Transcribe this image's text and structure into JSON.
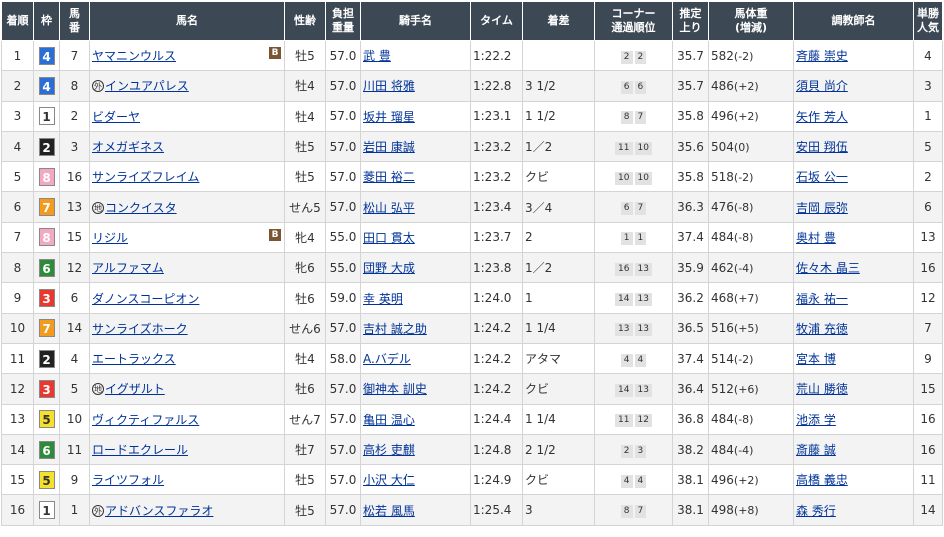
{
  "headers": {
    "rank": "着順",
    "waku": "枠",
    "umaban_1": "馬",
    "umaban_2": "番",
    "horse": "馬名",
    "sexage": "性齢",
    "weight_1": "負担",
    "weight_2": "重量",
    "jockey": "騎手名",
    "time": "タイム",
    "margin": "着差",
    "corner_1": "コーナー",
    "corner_2": "通過順位",
    "last3f_1": "推定",
    "last3f_2": "上り",
    "bw_1": "馬体重",
    "bw_2": "(増減)",
    "trainer": "調教師名",
    "pop_1": "単勝",
    "pop_2": "人気"
  },
  "waku_colors": {
    "1": {
      "bg": "#ffffff",
      "fg": "#333333"
    },
    "2": {
      "bg": "#222222",
      "fg": "#ffffff"
    },
    "3": {
      "bg": "#e8382f",
      "fg": "#ffffff"
    },
    "4": {
      "bg": "#2a6fd6",
      "fg": "#ffffff"
    },
    "5": {
      "bg": "#f5e12c",
      "fg": "#333333"
    },
    "6": {
      "bg": "#2f8a3b",
      "fg": "#ffffff"
    },
    "7": {
      "bg": "#f29b1d",
      "fg": "#ffffff"
    },
    "8": {
      "bg": "#f3a8c4",
      "fg": "#ffffff"
    }
  },
  "rows": [
    {
      "rank": "1",
      "waku": "4",
      "umaban": "7",
      "mark": "",
      "horse": "ヤマニンウルス",
      "blinker": "B",
      "sexage": "牡5",
      "weight": "57.0",
      "jockey": "武 豊",
      "time": "1:22.2",
      "margin": "",
      "c1": "2",
      "c2": "2",
      "last3f": "35.7",
      "bw": "582",
      "bwdiff": "(-2)",
      "trainer": "斉藤 崇史",
      "pop": "4"
    },
    {
      "rank": "2",
      "waku": "4",
      "umaban": "8",
      "mark": "外",
      "horse": "インユアパレス",
      "blinker": "",
      "sexage": "牡4",
      "weight": "57.0",
      "jockey": "川田 将雅",
      "time": "1:22.8",
      "margin": "3 1/2",
      "c1": "6",
      "c2": "6",
      "last3f": "35.7",
      "bw": "486",
      "bwdiff": "(+2)",
      "trainer": "須貝 尚介",
      "pop": "3"
    },
    {
      "rank": "3",
      "waku": "1",
      "umaban": "2",
      "mark": "",
      "horse": "ビダーヤ",
      "blinker": "",
      "sexage": "牡4",
      "weight": "57.0",
      "jockey": "坂井 瑠星",
      "time": "1:23.1",
      "margin": "1 1/2",
      "c1": "8",
      "c2": "7",
      "last3f": "35.8",
      "bw": "496",
      "bwdiff": "(+2)",
      "trainer": "矢作 芳人",
      "pop": "1"
    },
    {
      "rank": "4",
      "waku": "2",
      "umaban": "3",
      "mark": "",
      "horse": "オメガギネス",
      "blinker": "",
      "sexage": "牡5",
      "weight": "57.0",
      "jockey": "岩田 康誠",
      "time": "1:23.2",
      "margin": "1／2",
      "c1": "11",
      "c2": "10",
      "last3f": "35.6",
      "bw": "504",
      "bwdiff": "(0)",
      "trainer": "安田 翔伍",
      "pop": "5"
    },
    {
      "rank": "5",
      "waku": "8",
      "umaban": "16",
      "mark": "",
      "horse": "サンライズフレイム",
      "blinker": "",
      "sexage": "牡5",
      "weight": "57.0",
      "jockey": "菱田 裕二",
      "time": "1:23.2",
      "margin": "クビ",
      "c1": "10",
      "c2": "10",
      "last3f": "35.8",
      "bw": "518",
      "bwdiff": "(-2)",
      "trainer": "石坂 公一",
      "pop": "2"
    },
    {
      "rank": "6",
      "waku": "7",
      "umaban": "13",
      "mark": "地",
      "horse": "コンクイスタ",
      "blinker": "",
      "sexage": "せん5",
      "weight": "57.0",
      "jockey": "松山 弘平",
      "time": "1:23.4",
      "margin": "3／4",
      "c1": "6",
      "c2": "7",
      "last3f": "36.3",
      "bw": "476",
      "bwdiff": "(-8)",
      "trainer": "吉岡 辰弥",
      "pop": "6"
    },
    {
      "rank": "7",
      "waku": "8",
      "umaban": "15",
      "mark": "",
      "horse": "リジル",
      "blinker": "B",
      "sexage": "牝4",
      "weight": "55.0",
      "jockey": "田口 貫太",
      "time": "1:23.7",
      "margin": "2",
      "c1": "1",
      "c2": "1",
      "last3f": "37.4",
      "bw": "484",
      "bwdiff": "(-8)",
      "trainer": "奥村 豊",
      "pop": "13"
    },
    {
      "rank": "8",
      "waku": "6",
      "umaban": "12",
      "mark": "",
      "horse": "アルファマム",
      "blinker": "",
      "sexage": "牝6",
      "weight": "55.0",
      "jockey": "団野 大成",
      "time": "1:23.8",
      "margin": "1／2",
      "c1": "16",
      "c2": "13",
      "last3f": "35.9",
      "bw": "462",
      "bwdiff": "(-4)",
      "trainer": "佐々木 晶三",
      "pop": "16"
    },
    {
      "rank": "9",
      "waku": "3",
      "umaban": "6",
      "mark": "",
      "horse": "ダノンスコーピオン",
      "blinker": "",
      "sexage": "牡6",
      "weight": "59.0",
      "jockey": "幸 英明",
      "time": "1:24.0",
      "margin": "1",
      "c1": "14",
      "c2": "13",
      "last3f": "36.2",
      "bw": "468",
      "bwdiff": "(+7)",
      "trainer": "福永 祐一",
      "pop": "12"
    },
    {
      "rank": "10",
      "waku": "7",
      "umaban": "14",
      "mark": "",
      "horse": "サンライズホーク",
      "blinker": "",
      "sexage": "せん6",
      "weight": "57.0",
      "jockey": "吉村 誠之助",
      "time": "1:24.2",
      "margin": "1 1/4",
      "c1": "13",
      "c2": "13",
      "last3f": "36.5",
      "bw": "516",
      "bwdiff": "(+5)",
      "trainer": "牧浦 充徳",
      "pop": "7"
    },
    {
      "rank": "11",
      "waku": "2",
      "umaban": "4",
      "mark": "",
      "horse": "エートラックス",
      "blinker": "",
      "sexage": "牡4",
      "weight": "58.0",
      "jockey": "A.バデル",
      "time": "1:24.2",
      "margin": "アタマ",
      "c1": "4",
      "c2": "4",
      "last3f": "37.4",
      "bw": "514",
      "bwdiff": "(-2)",
      "trainer": "宮本 博",
      "pop": "9"
    },
    {
      "rank": "12",
      "waku": "3",
      "umaban": "5",
      "mark": "地",
      "horse": "イグザルト",
      "blinker": "",
      "sexage": "牡6",
      "weight": "57.0",
      "jockey": "御神本 訓史",
      "time": "1:24.2",
      "margin": "クビ",
      "c1": "14",
      "c2": "13",
      "last3f": "36.4",
      "bw": "512",
      "bwdiff": "(+6)",
      "trainer": "荒山 勝徳",
      "pop": "15"
    },
    {
      "rank": "13",
      "waku": "5",
      "umaban": "10",
      "mark": "",
      "horse": "ヴィクティファルス",
      "blinker": "",
      "sexage": "せん7",
      "weight": "57.0",
      "jockey": "亀田 温心",
      "time": "1:24.4",
      "margin": "1 1/4",
      "c1": "11",
      "c2": "12",
      "last3f": "36.8",
      "bw": "484",
      "bwdiff": "(-8)",
      "trainer": "池添 学",
      "pop": "16"
    },
    {
      "rank": "14",
      "waku": "6",
      "umaban": "11",
      "mark": "",
      "horse": "ロードエクレール",
      "blinker": "",
      "sexage": "牡7",
      "weight": "57.0",
      "jockey": "高杉 吏麒",
      "time": "1:24.8",
      "margin": "2 1/2",
      "c1": "2",
      "c2": "3",
      "last3f": "38.2",
      "bw": "484",
      "bwdiff": "(-4)",
      "trainer": "斎藤 誠",
      "pop": "16"
    },
    {
      "rank": "15",
      "waku": "5",
      "umaban": "9",
      "mark": "",
      "horse": "ライツフォル",
      "blinker": "",
      "sexage": "牡5",
      "weight": "57.0",
      "jockey": "小沢 大仁",
      "time": "1:24.9",
      "margin": "クビ",
      "c1": "4",
      "c2": "4",
      "last3f": "38.1",
      "bw": "496",
      "bwdiff": "(+2)",
      "trainer": "高橋 義忠",
      "pop": "11"
    },
    {
      "rank": "16",
      "waku": "1",
      "umaban": "1",
      "mark": "外",
      "horse": "アドバンスファラオ",
      "blinker": "",
      "sexage": "牡5",
      "weight": "57.0",
      "jockey": "松若 風馬",
      "time": "1:25.4",
      "margin": "3",
      "c1": "8",
      "c2": "7",
      "last3f": "38.1",
      "bw": "498",
      "bwdiff": "(+8)",
      "trainer": "森 秀行",
      "pop": "14"
    }
  ]
}
